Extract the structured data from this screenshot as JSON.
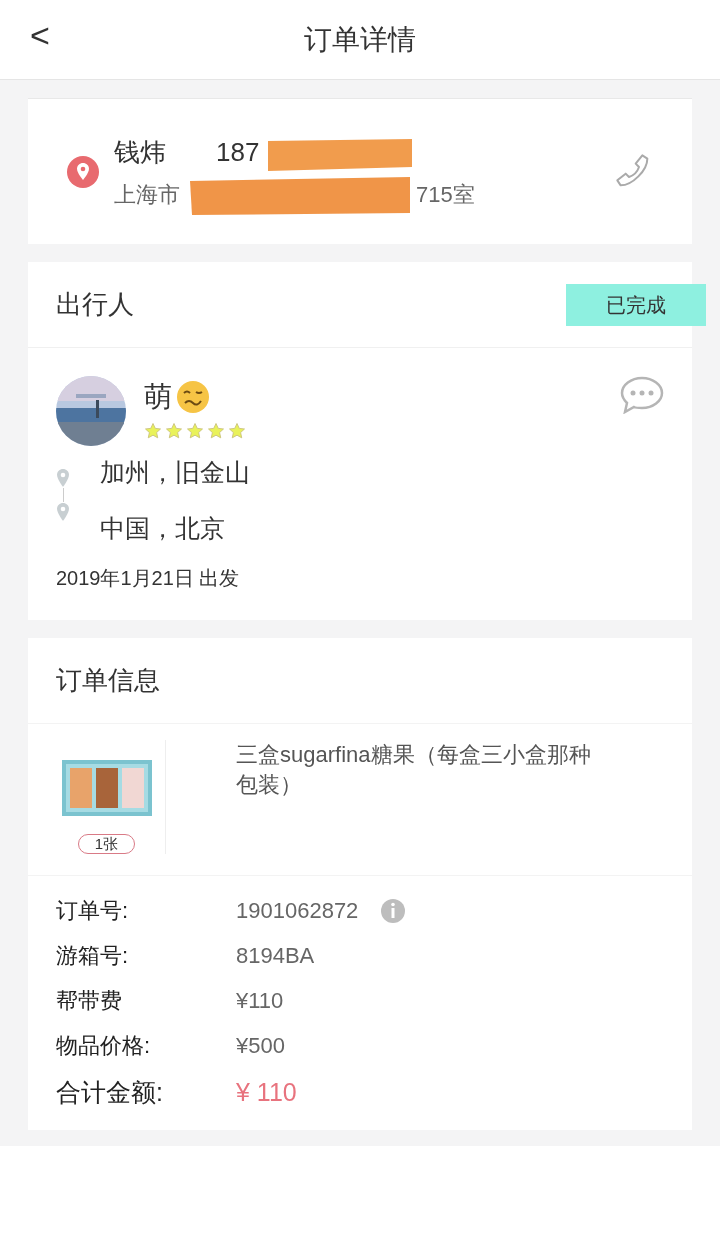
{
  "header": {
    "back": "<",
    "title": "订单详情"
  },
  "recipient": {
    "name": "钱炜",
    "phone": "187",
    "address_start": "上海市",
    "address_end": "715室"
  },
  "traveler": {
    "section_title": "出行人",
    "status": "已完成",
    "name": "萌",
    "stars": 5,
    "from": "加州，旧金山",
    "to": "中国，北京",
    "departure": "2019年1月21日 出发"
  },
  "order": {
    "section_title": "订单信息",
    "item": {
      "title": "三盒sugarfina糖果（每盒三小盒那种包装）",
      "quantity": "1张"
    },
    "rows": [
      {
        "kind": "normal",
        "label": "订单号:",
        "value": "1901062872",
        "info": true
      },
      {
        "kind": "normal",
        "label": "游箱号:",
        "value": "8194BA",
        "info": false
      },
      {
        "kind": "normal",
        "label": "帮带费",
        "value": "¥110",
        "info": false
      },
      {
        "kind": "normal",
        "label": "物品价格:",
        "value": "¥500",
        "info": false
      },
      {
        "kind": "total",
        "label": "合计金额:",
        "value": "¥ 110",
        "info": false
      }
    ]
  }
}
